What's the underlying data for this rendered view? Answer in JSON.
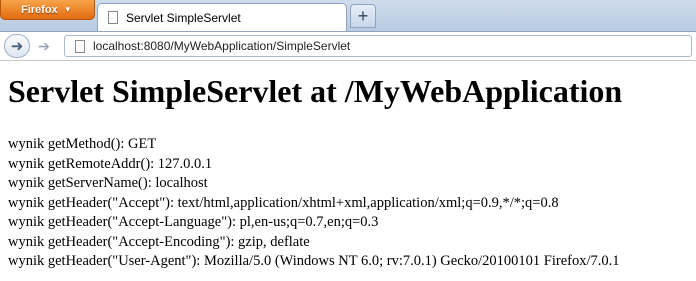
{
  "browser": {
    "menu_button_label": "Firefox",
    "tab_title": "Servlet SimpleServlet",
    "new_tab_symbol": "+",
    "address": "localhost:8080/MyWebApplication/SimpleServlet"
  },
  "page": {
    "heading": "Servlet SimpleServlet at /MyWebApplication",
    "lines": [
      "wynik getMethod(): GET",
      "wynik getRemoteAddr(): 127.0.0.1",
      "wynik getServerName(): localhost",
      "wynik getHeader(\"Accept\"): text/html,application/xhtml+xml,application/xml;q=0.9,*/*;q=0.8",
      "wynik getHeader(\"Accept-Language\"): pl,en-us;q=0.7,en;q=0.3",
      "wynik getHeader(\"Accept-Encoding\"): gzip, deflate",
      "wynik getHeader(\"User-Agent\"): Mozilla/5.0 (Windows NT 6.0; rv:7.0.1) Gecko/20100101 Firefox/7.0.1"
    ]
  },
  "icons": {
    "back": "back-arrow-icon",
    "forward": "forward-arrow-icon",
    "page": "page-icon"
  }
}
